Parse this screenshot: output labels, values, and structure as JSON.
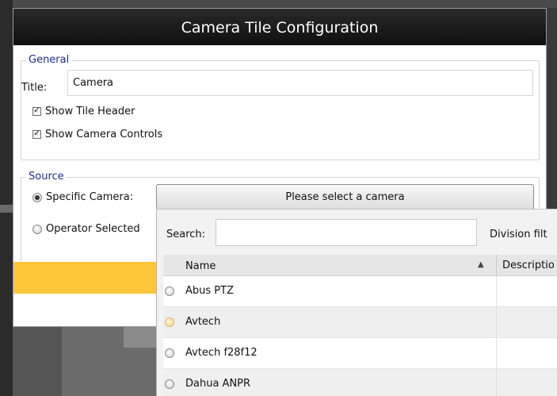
{
  "dialog": {
    "title": "Camera Tile Configuration"
  },
  "general": {
    "legend": "General",
    "title_label": "Title:",
    "title_value": "Camera",
    "show_tile_header": {
      "label": "Show Tile Header",
      "checked": true
    },
    "show_camera_controls": {
      "label": "Show Camera Controls",
      "checked": true
    }
  },
  "source": {
    "legend": "Source",
    "specific_camera_label": "Specific Camera:",
    "operator_selected_label": "Operator Selected",
    "select_button_label": "Please select a camera"
  },
  "camera_picker": {
    "search_label": "Search:",
    "search_value": "",
    "division_filter_label": "Division filt",
    "columns": {
      "name": "Name",
      "description": "Descriptio"
    },
    "sort_icon": "sort-ascending-icon",
    "rows": [
      {
        "name": "Abus PTZ",
        "highlighted": false
      },
      {
        "name": "Avtech",
        "highlighted": true
      },
      {
        "name": "Avtech f28f12",
        "highlighted": false
      },
      {
        "name": "Dahua ANPR",
        "highlighted": false
      }
    ]
  },
  "colors": {
    "titlebar": "#0f0f0f",
    "legend_text": "#1a2d8a",
    "accent_bar": "#fdc53a"
  }
}
